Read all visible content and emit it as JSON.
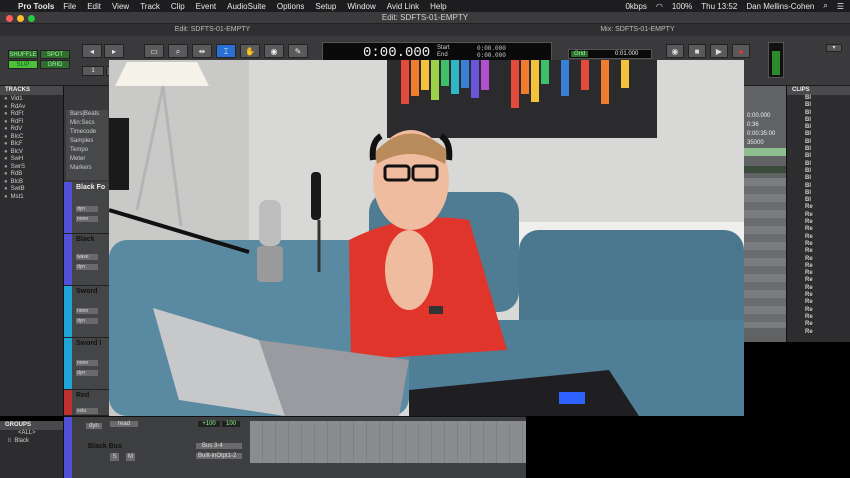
{
  "menubar": {
    "app_name": "Pro Tools",
    "items": [
      "File",
      "Edit",
      "View",
      "Track",
      "Clip",
      "Event",
      "AudioSuite",
      "Options",
      "Setup",
      "Window",
      "Avid Link",
      "Help"
    ],
    "net_rate": "0kbps",
    "battery": "100%",
    "clock": "Thu 13:52",
    "user": "Dan Mellins-Cohen"
  },
  "window": {
    "title": "Edit: SDFTS-01-EMPTY",
    "edit_title": "Edit: SDFTS-01-EMPTY",
    "mix_title": "Mix: SDFTS-01-EMPTY"
  },
  "toolbar": {
    "shuffle": "SHUFFLE",
    "spot": "SPOT",
    "slip": "SLIP",
    "grid": "GRID",
    "counter_main": "0:00.000",
    "start_label": "Start",
    "end_label": "End",
    "start_val": "0:00.000",
    "end_val": "0:00.000",
    "grid_label": "Grid",
    "grid_val": "0:01.000"
  },
  "tracks_panel": {
    "header": "TRACKS",
    "items": [
      "Vid1",
      "RdAv",
      "RdFt",
      "RdFl",
      "RdV",
      "BlcC",
      "BlcF",
      "BlcV",
      "SwH",
      "SwrS",
      "RdB",
      "BlcB",
      "SwtB",
      "Mst1"
    ]
  },
  "rulers": [
    "Bars|Beats",
    "Min:Secs",
    "Timecode",
    "Samples",
    "Tempo",
    "Meter",
    "Markers"
  ],
  "track_headers": [
    {
      "name": "Black Fo",
      "btn1": "dyn",
      "btn2": "none",
      "btn3": "none"
    },
    {
      "name": "Black",
      "btn1": "dyn",
      "btn2": "wave",
      "btn3": "volu"
    },
    {
      "name": "Sword",
      "btn1": "dyn",
      "btn2": "none",
      "btn3": "none"
    },
    {
      "name": "Sword I",
      "btn1": "dyn",
      "btn2": "none",
      "btn3": "none"
    },
    {
      "name": "Red",
      "btn1": "dyn",
      "btn2": "volu",
      "btn3": "dyn"
    }
  ],
  "right_col": [
    "0:00.000",
    "0:36",
    "0:00:35:00",
    "35000"
  ],
  "clips_panel": {
    "header": "CLIPS",
    "items": [
      "Bl",
      "Bl",
      "Bl",
      "Bl",
      "Bl",
      "Bl",
      "Bl",
      "Bl",
      "Bl",
      "Bl",
      "Bl",
      "Bl",
      "Bl",
      "Bl",
      "Bl",
      "Re",
      "Re",
      "Re",
      "Re",
      "Re",
      "Re",
      "Re",
      "Re",
      "Re",
      "Re",
      "Re",
      "Re",
      "Re",
      "Re",
      "Re",
      "Re",
      "Re",
      "Re"
    ]
  },
  "groups_panel": {
    "header": "GROUPS",
    "all": "<ALL>",
    "black": "Black"
  },
  "bottom_strip": {
    "track_name": "Black Bus",
    "mode": "read",
    "plus": "+100",
    "val": "100",
    "bus": "Bus 3-4",
    "output": "Built-inOtpt1-2",
    "dyn": "dyn",
    "s": "S",
    "m": "M"
  },
  "colors": {
    "menu_bg": "#1d1d1f",
    "panel_bg": "#2d2d2f",
    "toolbar_bg": "#3a3a3c",
    "track_blue": "#5050d8",
    "track_cyan": "#1fa5d6",
    "track_red": "#c03030",
    "shirt_red": "#e0352a"
  }
}
